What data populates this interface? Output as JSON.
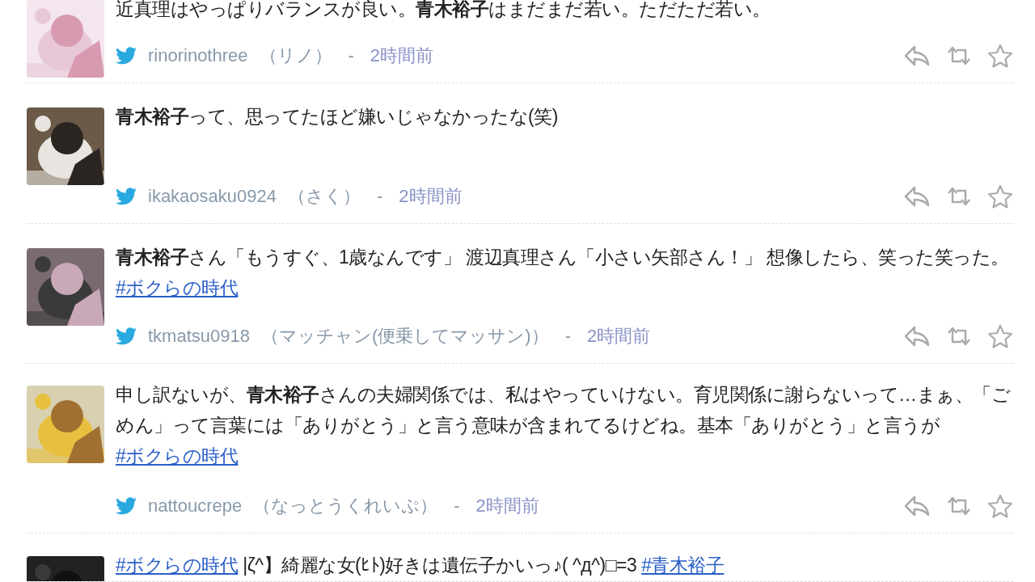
{
  "tweets": [
    {
      "avatar": {
        "kind": "picture"
      },
      "parts": [
        {
          "kind": "text",
          "text": "近真理はやっぱりバランスが良い。**青木裕子**はまだまだ若い。ただただ若い。"
        }
      ],
      "user": "rinorinothree",
      "display_name": "（リノ）",
      "separator": "-",
      "time": "2時間前"
    },
    {
      "avatar": {
        "kind": "picture"
      },
      "parts": [
        {
          "kind": "text",
          "text": "**青木裕子**って、思ってたほど嫌いじゃなかったな(笑)"
        }
      ],
      "user": "ikakaosaku0924",
      "display_name": "（さく）",
      "separator": "-",
      "time": "2時間前"
    },
    {
      "avatar": {
        "kind": "picture"
      },
      "parts": [
        {
          "kind": "text",
          "text": "**青木裕子**さん「もうすぐ、1歳なんです」 渡辺真理さん「小さい矢部さん！」 想像したら、笑った笑った。"
        },
        {
          "kind": "link",
          "text": "#ボクらの時代"
        }
      ],
      "user": "tkmatsu0918",
      "display_name": "（マッチャン(便乗してマッサン)）",
      "separator": "-",
      "time": "2時間前"
    },
    {
      "avatar": {
        "kind": "picture"
      },
      "parts": [
        {
          "kind": "text",
          "text": "申し訳ないが、**青木裕子**さんの夫婦関係では、私はやっていけない。育児関係に謝らないって…まぁ、「ごめん」って言葉には「ありがとう」と言う意味が含まれてるけどね。基本「ありがとう」と言うが "
        },
        {
          "kind": "link",
          "text": "#ボクらの時代"
        }
      ],
      "user": "nattoucrepe",
      "display_name": "（なっとうくれいぷ）",
      "separator": "-",
      "time": "2時間前"
    },
    {
      "avatar": {
        "kind": "picture"
      },
      "parts": [
        {
          "kind": "link",
          "text": "#ボクらの時代"
        },
        {
          "kind": "text",
          "text": " |ζ^】綺麗な女(ﾋﾄ)好きは遺伝子かいっ♪( ^д^)□=3 "
        },
        {
          "kind": "link",
          "text": "#青木裕子"
        }
      ]
    }
  ]
}
